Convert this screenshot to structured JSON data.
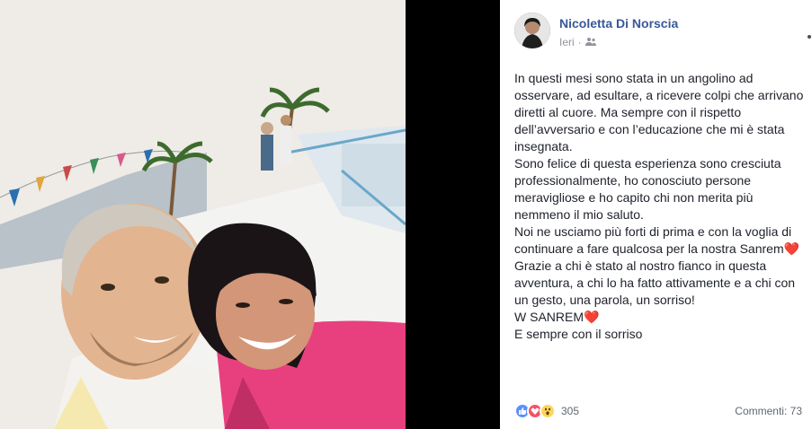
{
  "post": {
    "author": "Nicoletta Di Norscia",
    "timestamp": "Ieri",
    "audience_icon": "friends-icon",
    "more_icon": "more-options-icon",
    "paragraphs": [
      "In questi mesi sono stata in un angolino ad osservare, ad esultare, a ricevere colpi che arrivano diretti al cuore. Ma sempre con il rispetto dell’avversario e con l’educazione che mi è stata insegnata.",
      "Sono felice di questa esperienza sono cresciuta professionalmente, ho conosciuto persone meravigliose e ho capito chi non merita più nemmeno il mio saluto.",
      "Noi ne usciamo più forti di prima e con la voglia di continuare a fare qualcosa per la nostra Sanrem❤️",
      "Grazie a chi è stato al nostro fianco in questa avventura, a chi lo ha fatto attivamente e a chi con un gesto, una parola, un sorriso!",
      "W SANREM❤️",
      "E sempre con il sorriso"
    ]
  },
  "footer": {
    "reactions": [
      "like-icon",
      "love-icon",
      "wow-icon"
    ],
    "reaction_count": "305",
    "comments_label": "Commenti: 73"
  },
  "colors": {
    "author": "#385898",
    "meta": "#90949c",
    "like": "#5890ff",
    "love": "#f25268",
    "wow": "#fdd75a"
  }
}
